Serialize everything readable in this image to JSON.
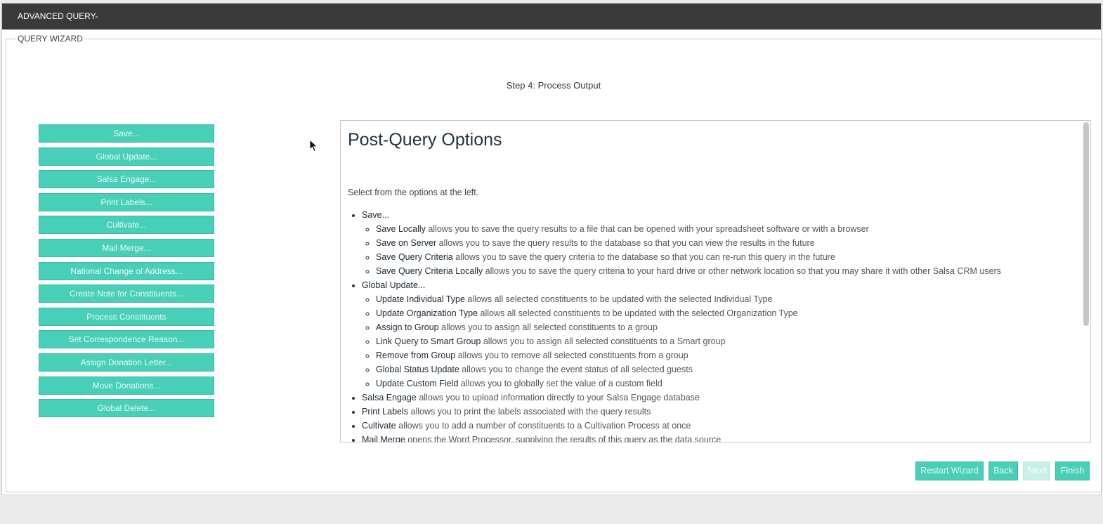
{
  "window": {
    "title": "ADVANCED QUERY-"
  },
  "wizard": {
    "legend": "QUERY WIZARD",
    "step_title": "Step 4: Process Output"
  },
  "options": [
    "Save...",
    "Global Update...",
    "Salsa Engage...",
    "Print Labels...",
    "Cultivate...",
    "Mail Merge...",
    "National Change of Address...",
    "Create Note for Constituents...",
    "Process Constituents",
    "Set Correspondence Reason...",
    "Assign Donation Letter...",
    "Move Donations...",
    "Global Delete..."
  ],
  "panel": {
    "heading": "Post-Query Options",
    "intro": "Select from the options at the left.",
    "sections": [
      {
        "label": "Save...",
        "items": [
          {
            "term": "Save Locally",
            "desc": " allows you to save the query results to a file that can be opened with your spreadsheet software or with a browser"
          },
          {
            "term": "Save on Server",
            "desc": " allows you to save the query results to the database so that you can view the results in the future"
          },
          {
            "term": "Save Query Criteria",
            "desc": " allows you to save the query criteria to the database so that you can re-run this query in the future"
          },
          {
            "term": "Save Query Criteria Locally",
            "desc": " allows you to save the query criteria to your hard drive or other network location so that you may share it with other Salsa CRM users"
          }
        ]
      },
      {
        "label": "Global Update...",
        "items": [
          {
            "term": "Update Individual Type",
            "desc": " allows all selected constituents to be updated with the selected Individual Type"
          },
          {
            "term": "Update Organization Type",
            "desc": " allows all selected constituents to be updated with the selected Organization Type"
          },
          {
            "term": "Assign to Group",
            "desc": " allows you to assign all selected constituents to a group"
          },
          {
            "term": "Link Query to Smart Group",
            "desc": " allows you to assign all selected constituents to a Smart group"
          },
          {
            "term": "Remove from Group",
            "desc": " allows you to remove all selected constituents from a group"
          },
          {
            "term": "Global Status Update",
            "desc": " allows you to change the event status of all selected guests"
          },
          {
            "term": "Update Custom Field",
            "desc": " allows you to globally set the value of a custom field"
          }
        ]
      }
    ],
    "bullets": [
      {
        "term": "Salsa Engage",
        "desc": " allows you to upload information directly to your Salsa Engage database"
      },
      {
        "term": "Print Labels",
        "desc": " allows you to print the labels associated with the query results"
      },
      {
        "term": "Cultivate",
        "desc": " allows you to add a number of constituents to a Cultivation Process at once"
      },
      {
        "term": "Mail Merge",
        "desc": " opens the Word Processor, supplying the results of this query as the data source"
      }
    ]
  },
  "footer": {
    "restart": "Restart Wizard",
    "back": "Back",
    "next": "Next",
    "finish": "Finish"
  }
}
